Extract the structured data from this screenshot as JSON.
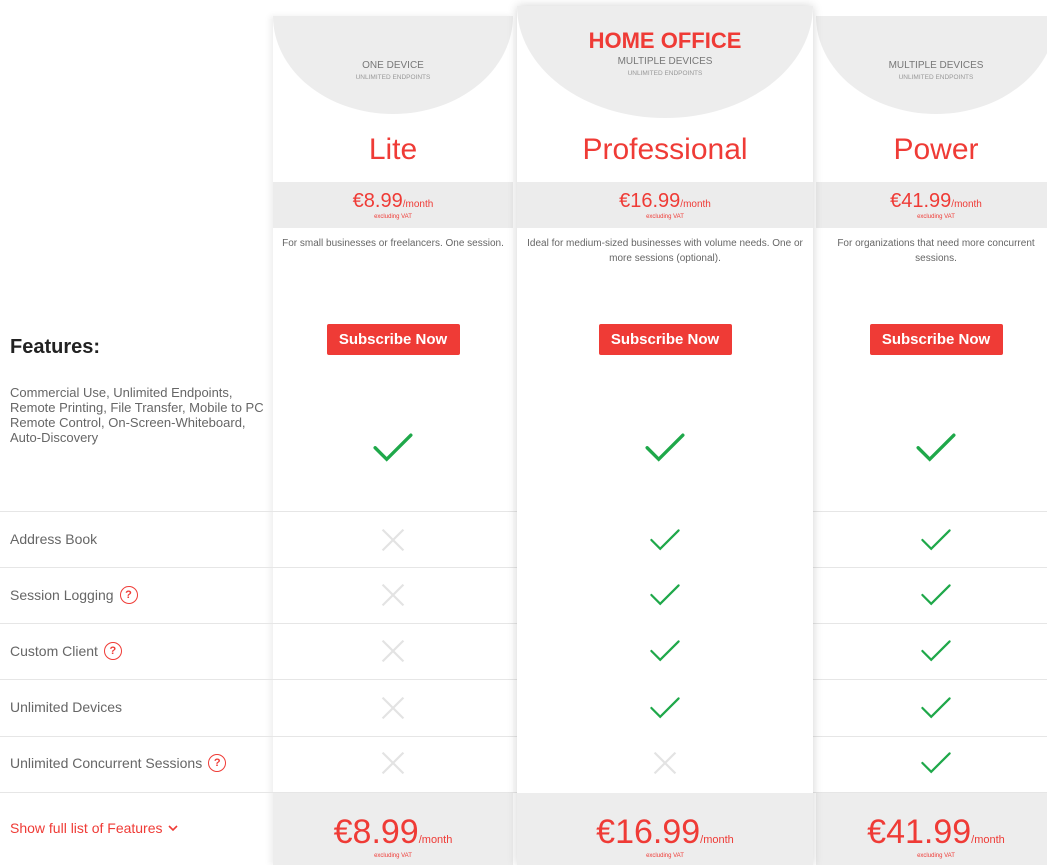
{
  "plans": [
    {
      "id": "lite",
      "highlight": "",
      "subtitle": "ONE DEVICE",
      "subtitle2": "UNLIMITED ENDPOINTS",
      "name": "Lite",
      "price": "€8.99",
      "per": "/month",
      "vat": "excluding VAT",
      "description": "For small businesses or freelancers. One session.",
      "button": "Subscribe Now",
      "features": [
        true,
        false,
        false,
        false,
        false,
        false
      ]
    },
    {
      "id": "professional",
      "highlight": "HOME OFFICE",
      "subtitle": "MULTIPLE DEVICES",
      "subtitle2": "UNLIMITED ENDPOINTS",
      "name": "Professional",
      "price": "€16.99",
      "per": "/month",
      "vat": "excluding VAT",
      "description": "Ideal for medium-sized businesses with volume needs. One or more sessions (optional).",
      "button": "Subscribe Now",
      "features": [
        true,
        true,
        true,
        true,
        true,
        false
      ]
    },
    {
      "id": "power",
      "highlight": "",
      "subtitle": "MULTIPLE DEVICES",
      "subtitle2": "UNLIMITED ENDPOINTS",
      "name": "Power",
      "price": "€41.99",
      "per": "/month",
      "vat": "excluding VAT",
      "description": "For organizations that need more concurrent sessions.",
      "button": "Subscribe Now",
      "features": [
        true,
        true,
        true,
        true,
        true,
        true
      ]
    }
  ],
  "features_title": "Features:",
  "features_base": "Commercial Use, Unlimited Endpoints, Remote Printing, File Transfer, Mobile to PC Remote Control, On-Screen-Whiteboard, Auto-Discovery",
  "feature_rows": [
    {
      "label": "Address Book",
      "help": false
    },
    {
      "label": "Session Logging",
      "help": true
    },
    {
      "label": "Custom Client",
      "help": true
    },
    {
      "label": "Unlimited Devices",
      "help": false
    },
    {
      "label": "Unlimited Concurrent Sessions",
      "help": true
    }
  ],
  "show_full_list": "Show full list of Features",
  "colors": {
    "accent": "#ef3b36",
    "check": "#1fa84a",
    "cross": "#e3e3e3",
    "band": "#ececec"
  }
}
